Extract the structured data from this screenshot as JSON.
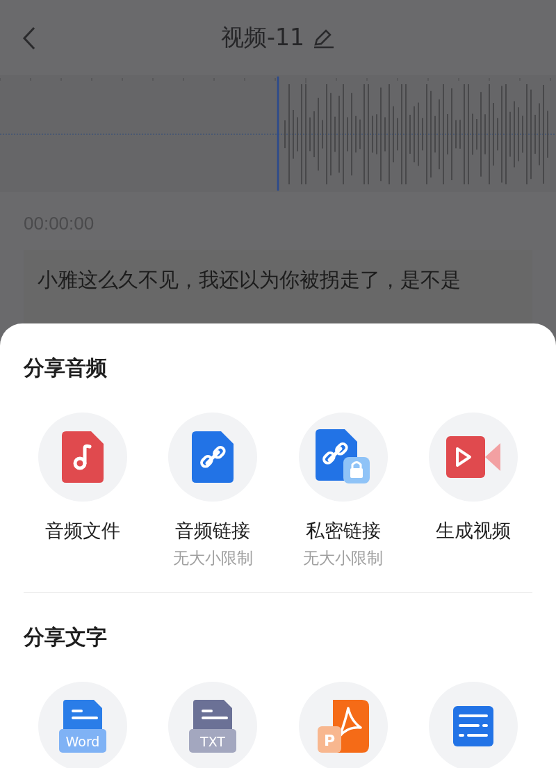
{
  "header": {
    "title": "视频-11"
  },
  "player": {
    "time": "00:00:00"
  },
  "transcript": {
    "lines": [
      "小雅这么久不见，我还以为你被拐走了，是不是"
    ]
  },
  "share_sheet": {
    "sections": [
      {
        "title": "分享音频",
        "items": [
          {
            "kind": "audio-file",
            "label": "音频文件"
          },
          {
            "kind": "audio-link",
            "label": "音频链接",
            "note": "无大小限制"
          },
          {
            "kind": "private-link",
            "label": "私密链接",
            "note": "无大小限制"
          },
          {
            "kind": "video",
            "label": "生成视频"
          }
        ]
      },
      {
        "title": "分享文字",
        "items": [
          {
            "kind": "word",
            "badge": "Word"
          },
          {
            "kind": "txt",
            "badge": "TXT"
          },
          {
            "kind": "pdf",
            "badge": "P"
          },
          {
            "kind": "text"
          }
        ]
      }
    ]
  }
}
